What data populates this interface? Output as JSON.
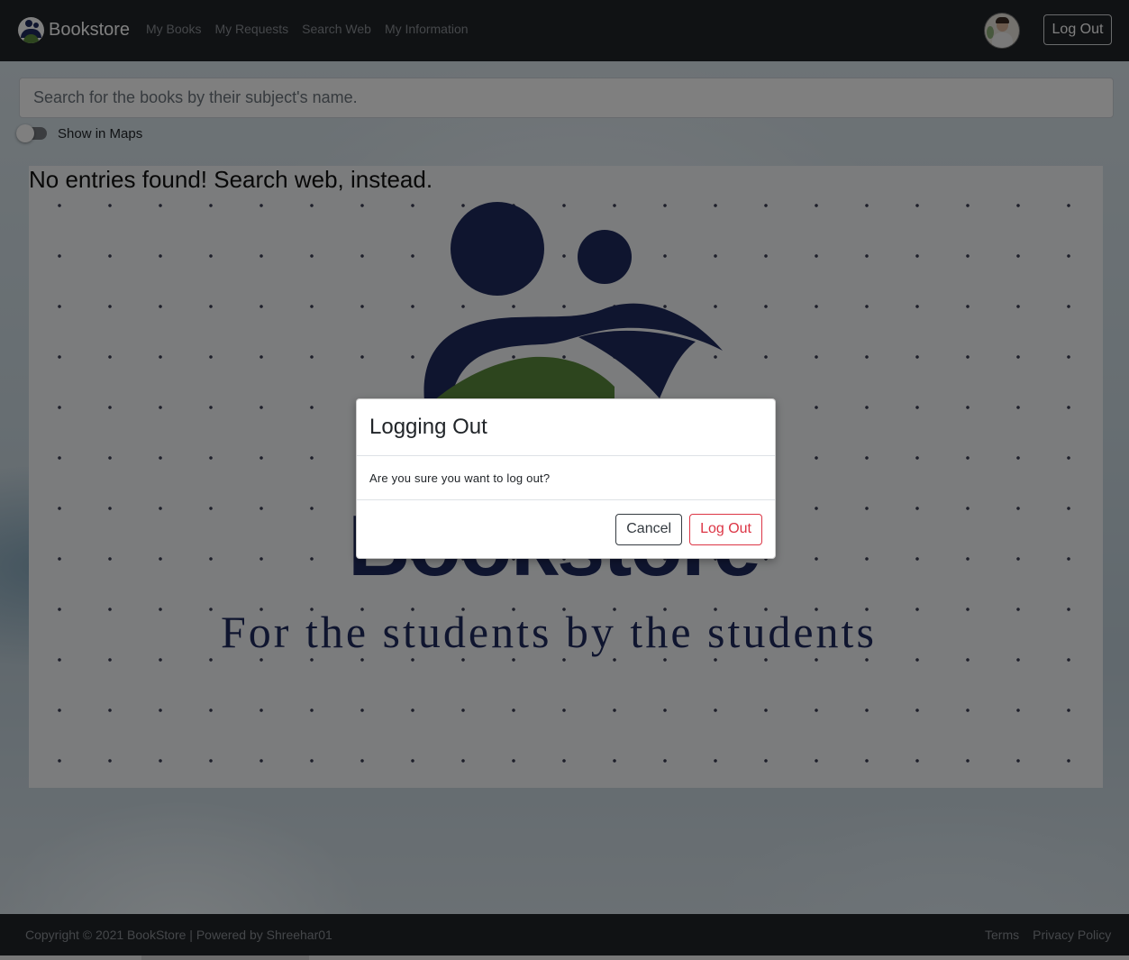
{
  "navbar": {
    "brand": "Bookstore",
    "links": [
      "My Books",
      "My Requests",
      "Search Web",
      "My Information"
    ],
    "logout_label": "Log Out"
  },
  "search": {
    "placeholder": "Search for the books by their subject's name."
  },
  "toggle": {
    "label": "Show in Maps",
    "checked": false
  },
  "content": {
    "no_entries": "No entries found! Search web, instead.",
    "wordmark": "Bookstore",
    "tagline": "For the students by the students"
  },
  "modal": {
    "title": "Logging Out",
    "message": "Are you sure you want to log out?",
    "cancel_label": "Cancel",
    "confirm_label": "Log Out"
  },
  "footer": {
    "copyright": "Copyright © 2021 BookStore | Powered by Shreehar01",
    "links": [
      "Terms",
      "Privacy Policy"
    ]
  },
  "colors": {
    "navbar_bg": "#212529",
    "brand_navy": "#1f2a5e",
    "brand_green": "#5a8a3c",
    "danger": "#dc3545"
  }
}
